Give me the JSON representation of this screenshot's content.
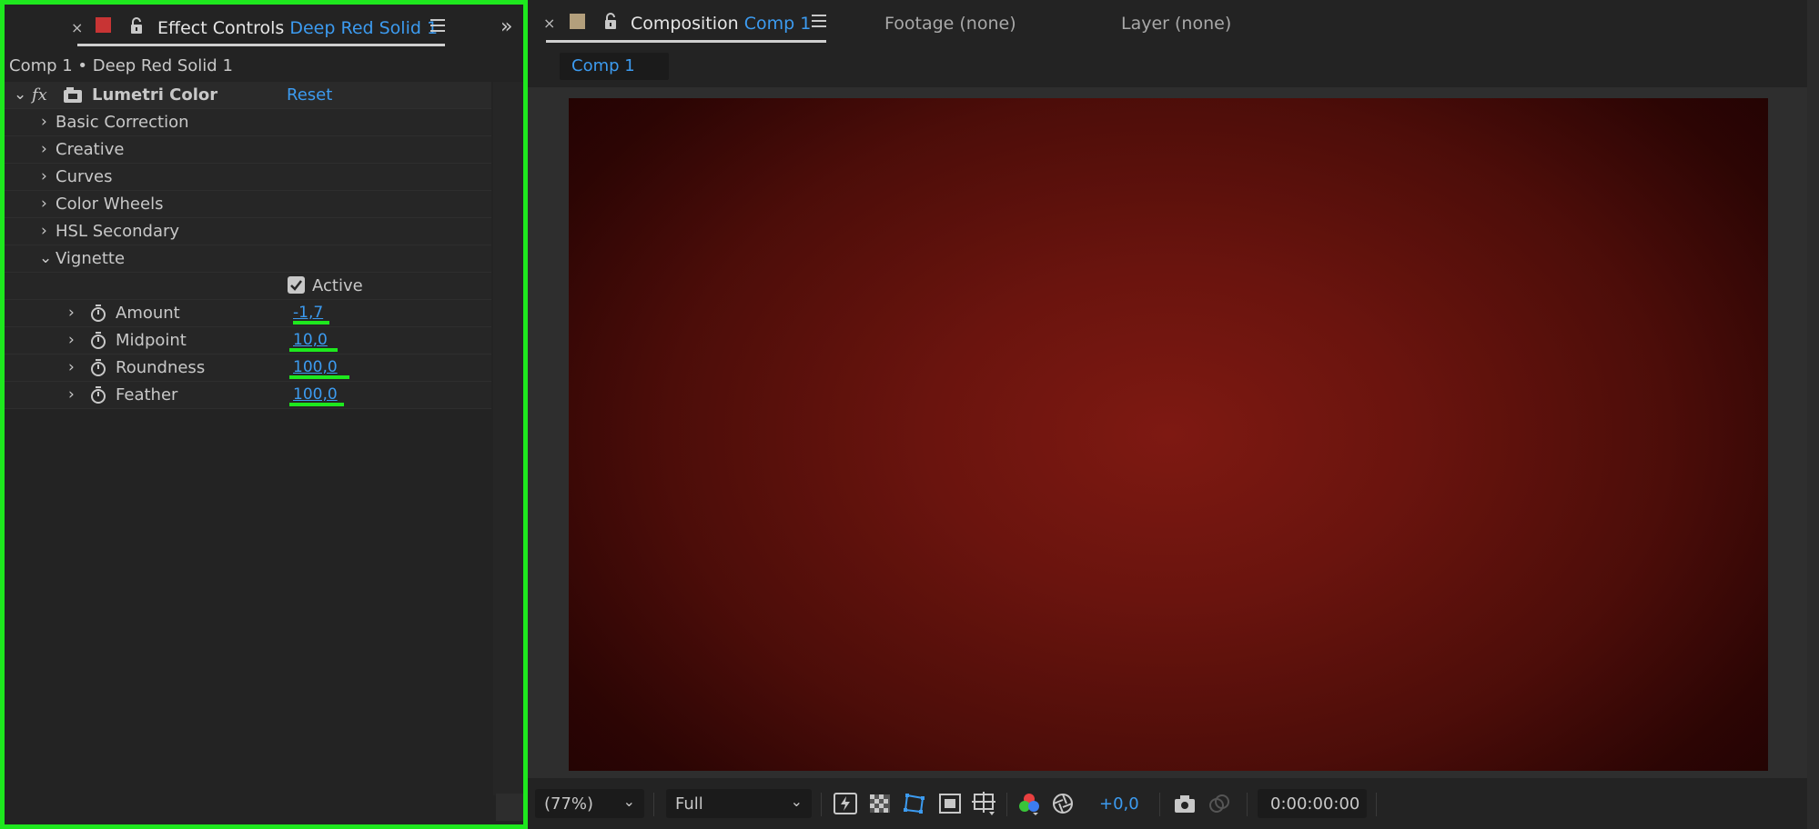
{
  "effect_controls": {
    "tab": {
      "close": "×",
      "title": "Effect Controls",
      "subject": "Deep Red Solid 1",
      "expand": "»"
    },
    "path": "Comp 1 • Deep Red Solid 1",
    "effect": {
      "fx": "fx",
      "name": "Lumetri Color",
      "reset": "Reset"
    },
    "sections": [
      {
        "label": "Basic Correction",
        "expanded": false
      },
      {
        "label": "Creative",
        "expanded": false
      },
      {
        "label": "Curves",
        "expanded": false
      },
      {
        "label": "Color Wheels",
        "expanded": false
      },
      {
        "label": "HSL Secondary",
        "expanded": false
      },
      {
        "label": "Vignette",
        "expanded": true
      }
    ],
    "active": {
      "label": "Active",
      "checked": true
    },
    "properties": [
      {
        "label": "Amount",
        "value": "-1,7"
      },
      {
        "label": "Midpoint",
        "value": "10,0"
      },
      {
        "label": "Roundness",
        "value": "100,0"
      },
      {
        "label": "Feather",
        "value": "100,0"
      }
    ]
  },
  "composition": {
    "tab": {
      "close": "×",
      "title": "Composition",
      "subject": "Comp 1"
    },
    "footage_tab": "Footage (none)",
    "layer_tab": "Layer (none)",
    "subtab": "Comp 1",
    "toolbar": {
      "zoom": "(77%)",
      "resolution": "Full",
      "exposure": "+0,0",
      "timecode": "0:00:00:00"
    }
  },
  "colors": {
    "highlight": "#1ee81e",
    "accent_blue": "#3c9bf0",
    "layer_swatch": "#c83434",
    "comp_swatch": "#b39f7c",
    "solid_center": "#7e1912",
    "solid_edge": "#1c0202"
  },
  "icons": [
    "close-icon",
    "panel-menu-icon",
    "lock-icon",
    "stopwatch-icon",
    "chevron-right-icon",
    "chevron-down-icon",
    "snapshot-icon",
    "channel-icon",
    "exposure-icon"
  ]
}
